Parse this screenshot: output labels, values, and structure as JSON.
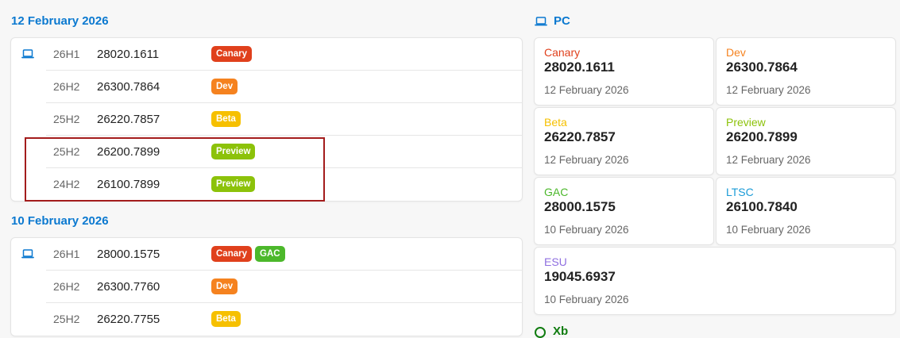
{
  "groups": [
    {
      "date": "12 February 2026",
      "rows": [
        {
          "version": "26H1",
          "build": "28020.1611",
          "badges": [
            {
              "label": "Canary",
              "color": "#e0401c"
            }
          ]
        },
        {
          "version": "26H2",
          "build": "26300.7864",
          "badges": [
            {
              "label": "Dev",
              "color": "#f5821f"
            }
          ]
        },
        {
          "version": "25H2",
          "build": "26220.7857",
          "badges": [
            {
              "label": "Beta",
              "color": "#f6c000"
            }
          ]
        },
        {
          "version": "25H2",
          "build": "26200.7899",
          "badges": [
            {
              "label": "Preview",
              "color": "#8cc20a"
            }
          ]
        },
        {
          "version": "24H2",
          "build": "26100.7899",
          "badges": [
            {
              "label": "Preview",
              "color": "#8cc20a"
            }
          ]
        }
      ]
    },
    {
      "date": "10 February 2026",
      "rows": [
        {
          "version": "26H1",
          "build": "28000.1575",
          "badges": [
            {
              "label": "Canary",
              "color": "#e0401c"
            },
            {
              "label": "GAC",
              "color": "#4cb82b"
            }
          ]
        },
        {
          "version": "26H2",
          "build": "26300.7760",
          "badges": [
            {
              "label": "Dev",
              "color": "#f5821f"
            }
          ]
        },
        {
          "version": "25H2",
          "build": "26220.7755",
          "badges": [
            {
              "label": "Beta",
              "color": "#f6c000"
            }
          ]
        }
      ]
    }
  ],
  "pc": {
    "title": "PC",
    "icon": "laptop-icon",
    "channels": [
      {
        "name": "Canary",
        "color": "#e0401c",
        "build": "28020.1611",
        "date": "12 February 2026"
      },
      {
        "name": "Dev",
        "color": "#f5821f",
        "build": "26300.7864",
        "date": "12 February 2026"
      },
      {
        "name": "Beta",
        "color": "#f6c000",
        "build": "26220.7857",
        "date": "12 February 2026"
      },
      {
        "name": "Preview",
        "color": "#8cc20a",
        "build": "26200.7899",
        "date": "12 February 2026"
      },
      {
        "name": "GAC",
        "color": "#4cb82b",
        "build": "28000.1575",
        "date": "10 February 2026"
      },
      {
        "name": "LTSC",
        "color": "#1a9bd7",
        "build": "26100.7840",
        "date": "10 February 2026"
      },
      {
        "name": "ESU",
        "color": "#8f6fe0",
        "build": "19045.6937",
        "date": "10 February 2026"
      }
    ]
  },
  "xbox_peek": {
    "label": "Xb"
  }
}
